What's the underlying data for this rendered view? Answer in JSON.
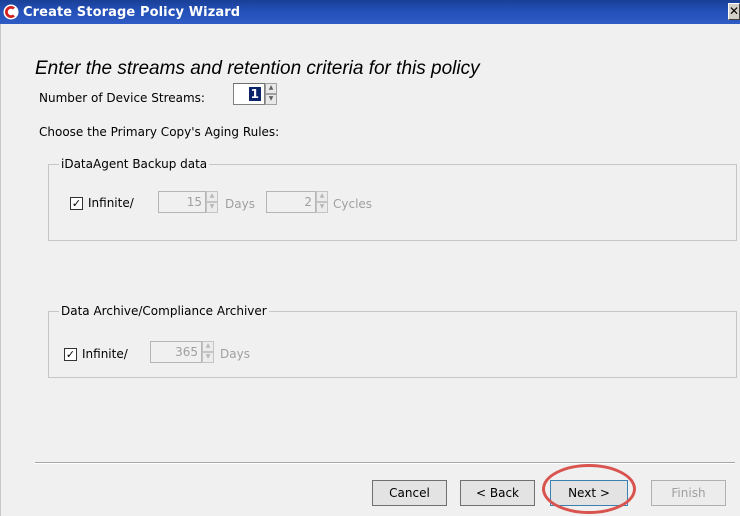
{
  "window": {
    "title": "Create Storage Policy Wizard",
    "close_glyph": "✕",
    "app_icon": "commvault-logo-icon"
  },
  "heading": "Enter the streams and retention criteria for this policy",
  "streams": {
    "label": "Number of Device Streams:",
    "value": "1"
  },
  "aging_label": "Choose the Primary Copy's Aging Rules:",
  "backup_group": {
    "legend": "iDataAgent Backup data",
    "checkbox_label": "Infinite/",
    "checked": true,
    "days_value": "15",
    "days_unit": "Days",
    "cycles_value": "2",
    "cycles_unit": "Cycles"
  },
  "archive_group": {
    "legend": "Data Archive/Compliance Archiver",
    "checkbox_label": "Infinite/",
    "checked": true,
    "days_value": "365",
    "days_unit": "Days"
  },
  "buttons": {
    "cancel": "Cancel",
    "back": "< Back",
    "next": "Next >",
    "finish": "Finish"
  },
  "colors": {
    "title_bar": "#2350b8",
    "highlight_ring": "#d9534f"
  }
}
